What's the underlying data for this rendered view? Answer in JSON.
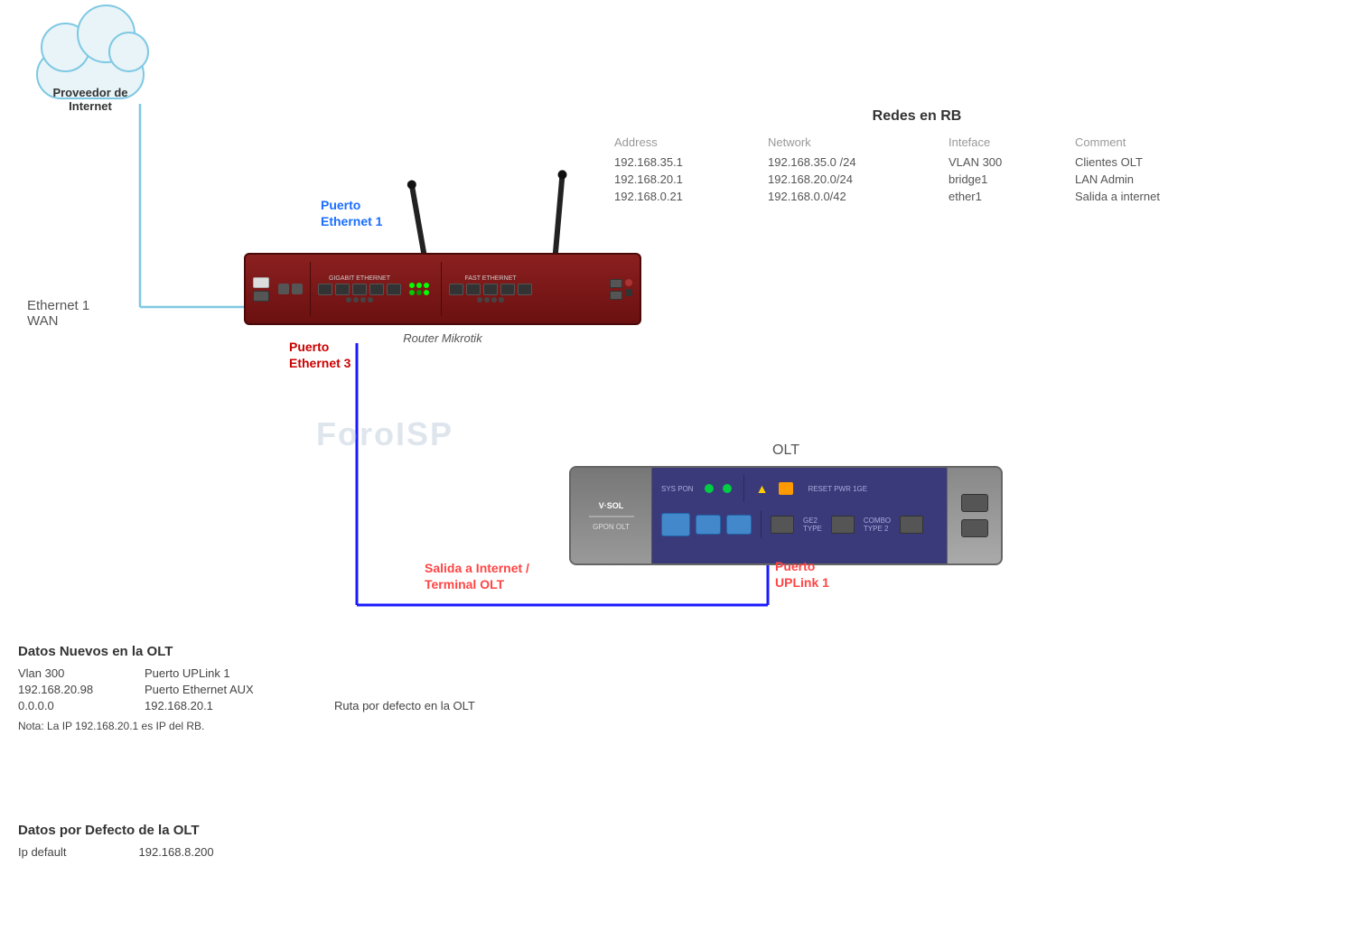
{
  "cloud": {
    "label_line1": "Proveedor de",
    "label_line2": "Internet"
  },
  "router": {
    "label": "Router Mikrotik",
    "port_eth1_label_line1": "Puerto",
    "port_eth1_label_line2": "Ethernet 1",
    "port_eth3_label_line1": "Puerto",
    "port_eth3_label_line2": "Ethernet 3"
  },
  "eth_wan": {
    "line1": "Ethernet 1",
    "line2": "WAN"
  },
  "network_table": {
    "title": "Redes en RB",
    "headers": [
      "Address",
      "Network",
      "Inteface",
      "Comment"
    ],
    "rows": [
      [
        "192.168.35.1",
        "192.168.35.0 /24",
        "VLAN 300",
        "Clientes OLT"
      ],
      [
        "192.168.20.1",
        "192.168.20.0/24",
        "bridge1",
        "LAN Admin"
      ],
      [
        "192.168.0.21",
        "192.168.0.0/42",
        "ether1",
        "Salida a internet"
      ]
    ]
  },
  "olt": {
    "title": "OLT",
    "logo": "V·SOL",
    "sublabel": "GPON OLT",
    "port_uplink_label_line1": "Puerto",
    "port_uplink_label_line2": "UPLink 1",
    "internet_label_line1": "Salida a Internet /",
    "internet_label_line2": "Terminal  OLT"
  },
  "watermark": "ForoISP",
  "bottom_datos_nuevos": {
    "title": "Datos Nuevos en  la OLT",
    "rows": [
      [
        "Vlan 300",
        "Puerto UPLink 1",
        ""
      ],
      [
        "192.168.20.98",
        "Puerto Ethernet AUX",
        ""
      ],
      [
        "0.0.0.0",
        "192.168.20.1",
        "Ruta  por defecto en la OLT"
      ]
    ],
    "note": "Nota: La IP 192.168.20.1 es IP del RB."
  },
  "bottom_datos_defecto": {
    "title": "Datos por Defecto de la OLT",
    "ip_label": "Ip default",
    "ip_value": "192.168.8.200"
  }
}
